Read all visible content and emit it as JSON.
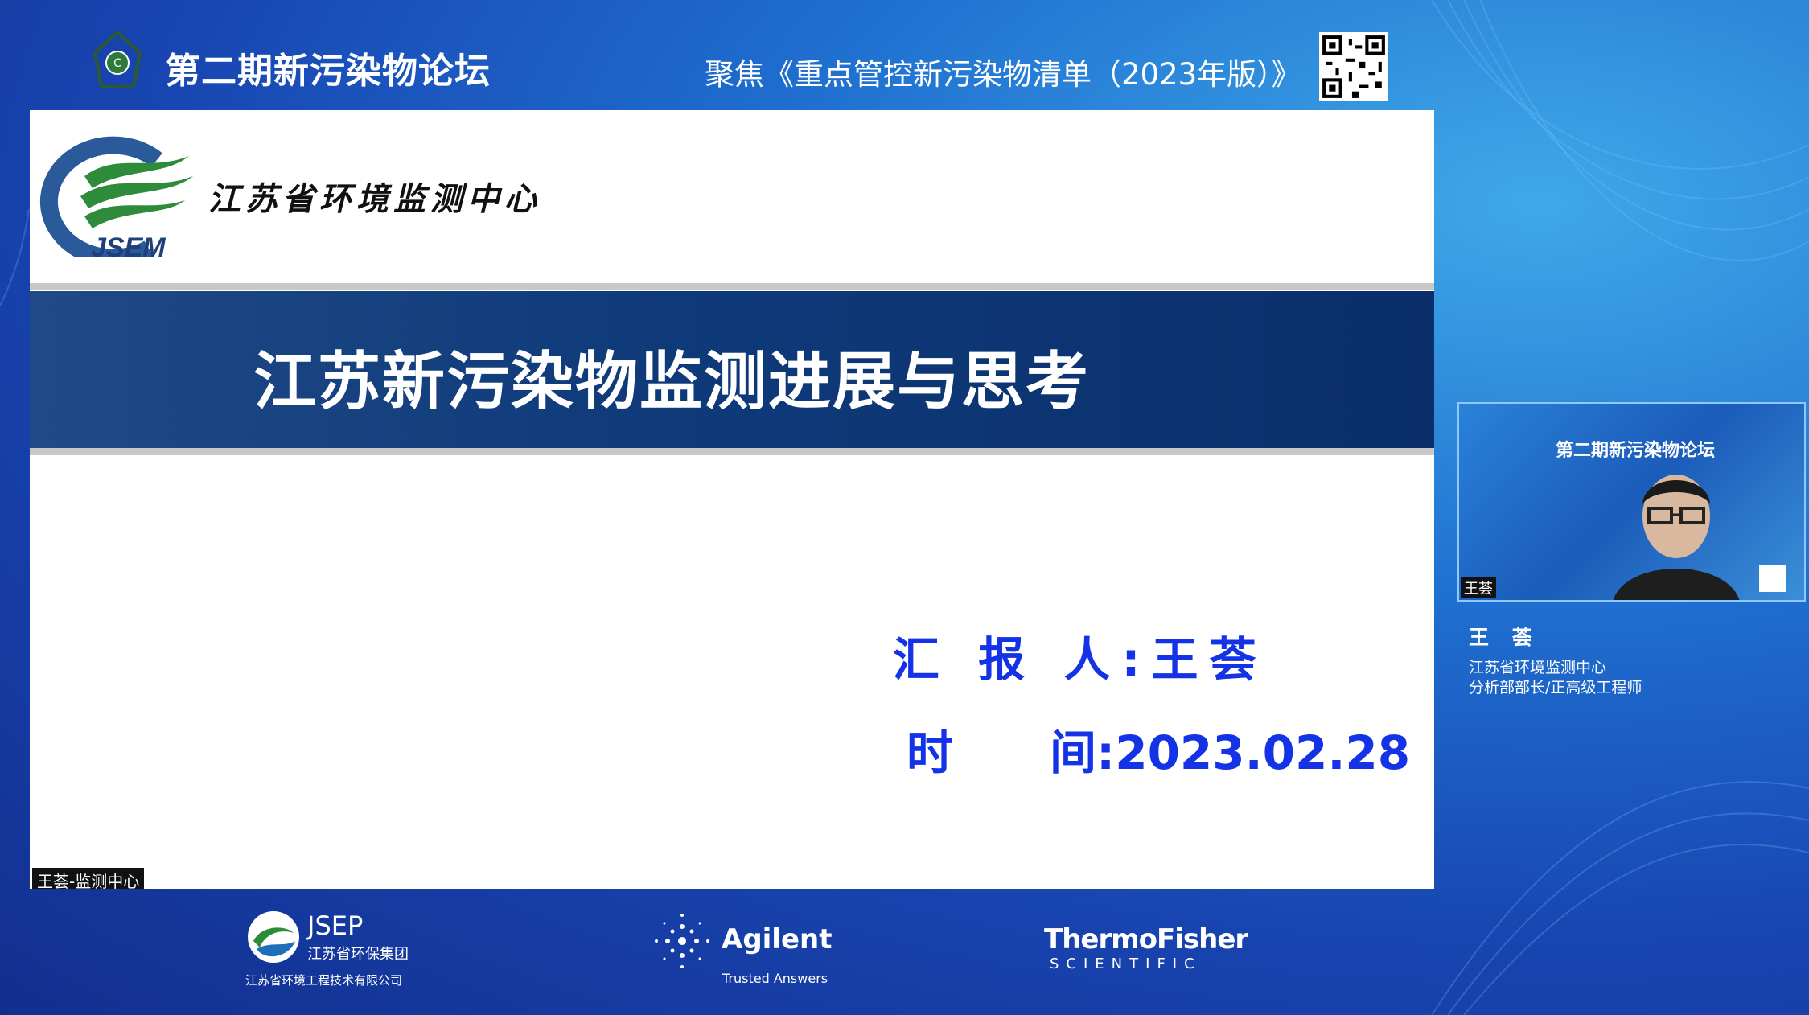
{
  "header": {
    "forum_title": "第二期新污染物论坛",
    "focus_text": "聚焦《重点管控新污染物清单（2023年版）》"
  },
  "slide": {
    "org_name": "江苏省环境监测中心",
    "logo_text": "JSEM",
    "title": "江苏新污染物监测进展与思考",
    "reporter_label": "汇 报 人:",
    "reporter_name": "王荟",
    "date_label_1": "时",
    "date_label_2": "间:",
    "date_value": "2023.02.28"
  },
  "participant_tag": "王荟-监测中心",
  "speaker": {
    "video_title": "第二期新污染物论坛",
    "video_name_tag": "王荟",
    "name": "王 荟",
    "organization": "江苏省环境监测中心",
    "role": "分析部部长/正高级工程师"
  },
  "sponsors": {
    "jsep_name": "JSEP",
    "jsep_cn": "江苏省环保集团",
    "jsep_company": "江苏省环境工程技术有限公司",
    "agilent_name": "Agilent",
    "agilent_tagline": "Trusted Answers",
    "thermo_name": "ThermoFisher",
    "thermo_sub": "SCIENTIFIC"
  },
  "colors": {
    "accent_blue": "#1432e6",
    "band_navy": "#0f3a7a",
    "logo_green": "#2e8b3a"
  }
}
